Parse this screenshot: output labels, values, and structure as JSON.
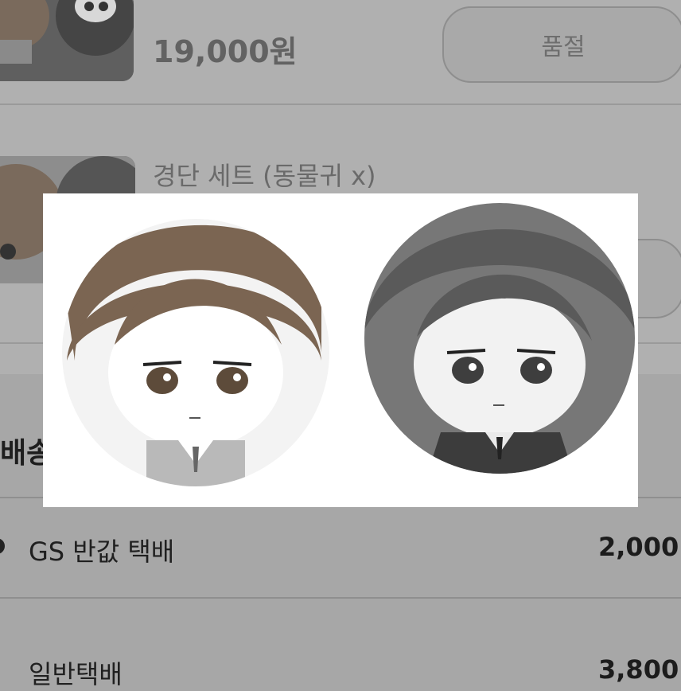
{
  "items": [
    {
      "price": "19,000원",
      "status_button": "품절"
    },
    {
      "name": "경단 세트 (동물귀 x)"
    }
  ],
  "shipping": {
    "heading": "배송",
    "options": [
      {
        "label": "GS 반값 택배",
        "price": "2,000"
      },
      {
        "label": "일반택배",
        "price": "3,800"
      }
    ]
  },
  "overlay": {
    "avatars": [
      {
        "name": "brown-hair-character-avatar",
        "hair_color": "#7b6552",
        "bg_color": "#f0f0f0"
      },
      {
        "name": "dark-hair-character-avatar",
        "hair_color": "#5a5a5a",
        "bg_color": "#7a7a7a"
      }
    ]
  }
}
